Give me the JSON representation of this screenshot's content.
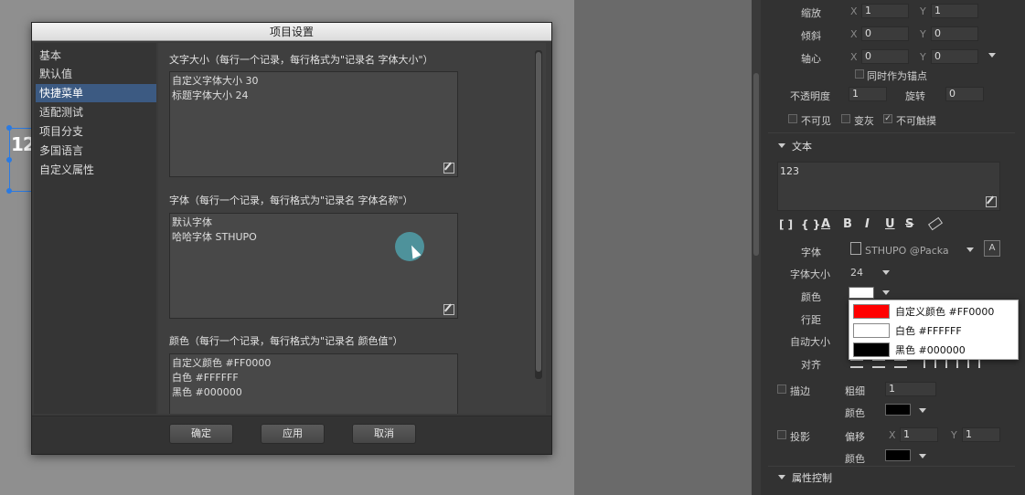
{
  "dialog": {
    "title": "项目设置",
    "nav": [
      "基本",
      "默认值",
      "快捷菜单",
      "适配测试",
      "项目分支",
      "多国语言",
      "自定义属性"
    ],
    "font_size_section": {
      "label": "文字大小（每行一个记录，每行格式为\"记录名 字体大小\"）",
      "lines": [
        "自定义字体大小 30",
        "标题字体大小 24"
      ]
    },
    "font_section": {
      "label": "字体（每行一个记录，每行格式为\"记录名 字体名称\"）",
      "lines": [
        "默认字体",
        "哈哈字体 STHUPO"
      ]
    },
    "color_section": {
      "label": "颜色（每行一个记录，每行格式为\"记录名 颜色值\"）",
      "lines": [
        "自定义颜色 #FF0000",
        "白色 #FFFFFF",
        "黑色 #000000"
      ]
    },
    "buttons": {
      "ok": "确定",
      "apply": "应用",
      "cancel": "取消"
    }
  },
  "canvas": {
    "object_text": "12"
  },
  "panel": {
    "scale_label": "缩放",
    "scale_x": "1",
    "scale_y": "1",
    "skew_label": "倾斜",
    "skew_x": "0",
    "skew_y": "0",
    "pivot_label": "轴心",
    "pivot_x": "0",
    "pivot_y": "0",
    "pivot_anchor": "同时作为锚点",
    "opacity_label": "不透明度",
    "opacity": "1",
    "rotation_label": "旋转",
    "rotation": "0",
    "invisible": "不可见",
    "gray": "变灰",
    "untouchable": "不可触摸",
    "axis_x": "X",
    "axis_y": "Y",
    "text_section": "文本",
    "text_value": "123",
    "font_label": "字体",
    "font_value": "STHUPO @Packa",
    "font_size_label": "字体大小",
    "font_size_value": "24",
    "color_label": "颜色",
    "line_spacing_label": "行距",
    "auto_size_label": "自动大小",
    "align_label": "对齐",
    "stroke_label": "描边",
    "stroke_width_label": "粗细",
    "stroke_width": "1",
    "stroke_color_label": "颜色",
    "shadow_label": "投影",
    "shadow_offset_label": "偏移",
    "shadow_x": "1",
    "shadow_y": "1",
    "shadow_color_label": "颜色",
    "props_section": "属性控制",
    "format_buttons": [
      "[ ]",
      "{ }",
      "A",
      "B",
      "I",
      "U",
      "S"
    ]
  },
  "color_popup": [
    {
      "label": "自定义颜色 #FF0000",
      "color": "#FF0000"
    },
    {
      "label": "白色 #FFFFFF",
      "color": "#FFFFFF"
    },
    {
      "label": "黑色 #000000",
      "color": "#000000"
    }
  ]
}
